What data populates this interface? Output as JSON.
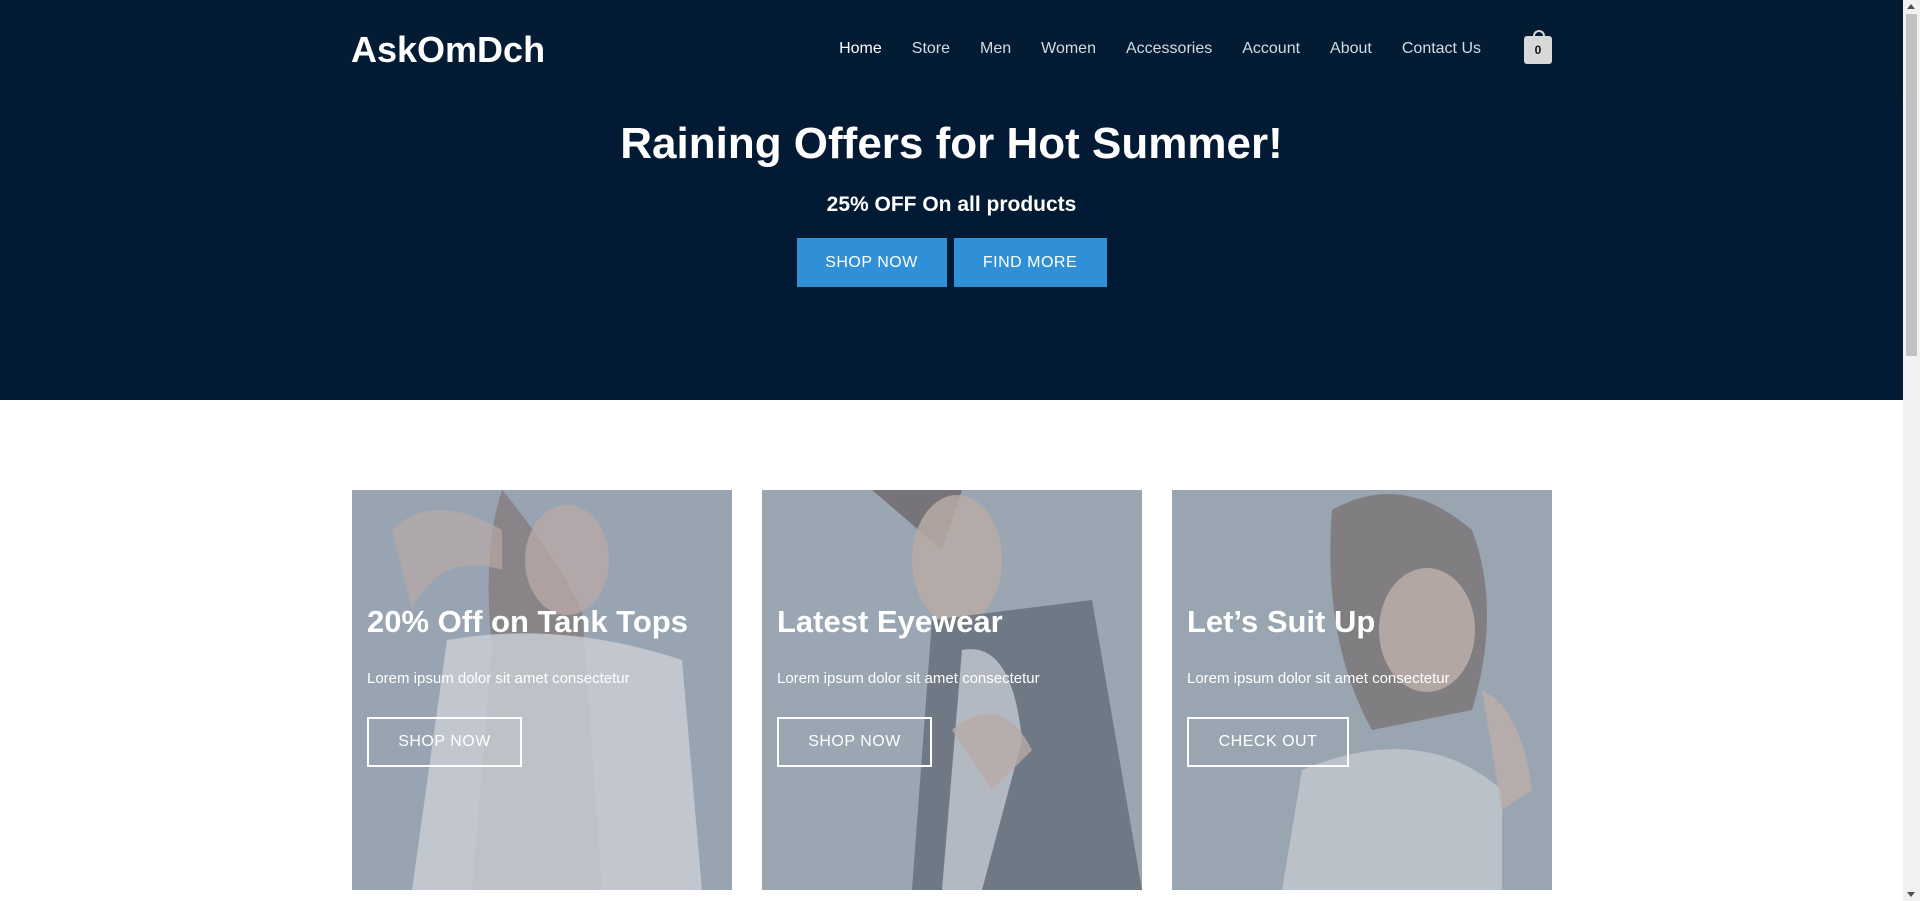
{
  "header": {
    "logo": "AskOmDch",
    "nav": [
      {
        "label": "Home",
        "active": true
      },
      {
        "label": "Store"
      },
      {
        "label": "Men"
      },
      {
        "label": "Women"
      },
      {
        "label": "Accessories"
      },
      {
        "label": "Account"
      },
      {
        "label": "About"
      },
      {
        "label": "Contact Us"
      }
    ],
    "cart_count": "0",
    "cart_icon": "shopping-bag-icon"
  },
  "hero": {
    "title": "Raining Offers for Hot Summer!",
    "subtitle": "25% OFF On all products",
    "buttons": [
      "SHOP NOW",
      "FIND MORE"
    ],
    "background_color": "#021a33",
    "button_color": "#2f90d8"
  },
  "promos": [
    {
      "title": "20% Off on Tank Tops",
      "text": "Lorem ipsum dolor sit amet consectetur",
      "button": "SHOP NOW"
    },
    {
      "title": "Latest Eyewear",
      "text": "Lorem ipsum dolor sit amet consectetur",
      "button": "SHOP NOW"
    },
    {
      "title": "Let’s Suit Up",
      "text": "Lorem ipsum dolor sit amet consectetur",
      "button": "CHECK OUT"
    }
  ]
}
